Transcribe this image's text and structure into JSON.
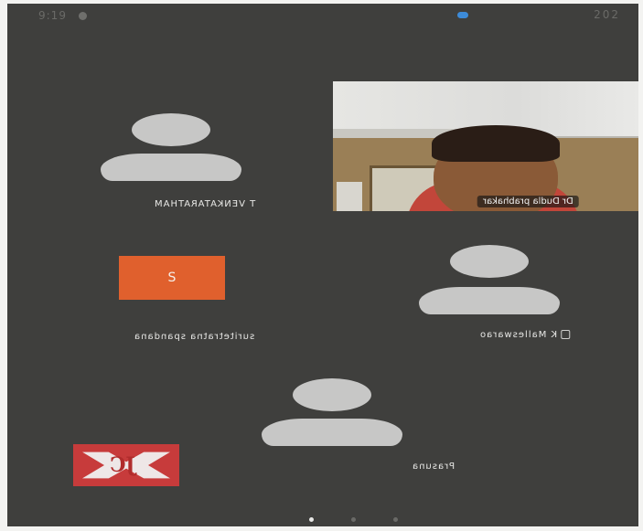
{
  "status_bar": {
    "left_text": "9:19",
    "right_text": "202"
  },
  "participants": [
    {
      "name": "T VENKATARATHAM",
      "avatar_type": "placeholder"
    },
    {
      "name": "Dr Dudla prabhakar",
      "avatar_type": "video"
    },
    {
      "name": "suritetratna spandana",
      "avatar_type": "initial",
      "initial": "S",
      "color": "#e0602d"
    },
    {
      "name": "K Malleswarao",
      "avatar_type": "placeholder",
      "muted": true
    },
    {
      "name": "Prasuna",
      "avatar_type": "placeholder"
    }
  ],
  "self_view": {
    "text": "JC"
  },
  "page_indicator": {
    "pages": 3,
    "active": 0
  }
}
